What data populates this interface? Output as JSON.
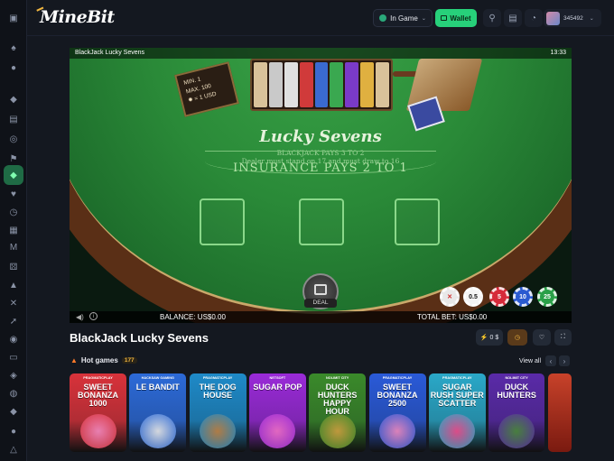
{
  "brand": "MineBit",
  "topbar": {
    "ingame_label": "In Game",
    "wallet_label": "Wallet",
    "user_id": "345492"
  },
  "sidebar": {
    "items": [
      {
        "icon": "collapse-icon",
        "glyph": "▣"
      },
      {
        "icon": "spade-icon",
        "glyph": "♠"
      },
      {
        "icon": "basketball-icon",
        "glyph": "●"
      },
      {
        "icon": "chat-icon",
        "glyph": "◆"
      },
      {
        "icon": "gift-icon",
        "glyph": "▤"
      },
      {
        "icon": "target-icon",
        "glyph": "◎"
      },
      {
        "icon": "flag-icon",
        "glyph": "⚑"
      },
      {
        "icon": "diamond-icon",
        "glyph": "◆",
        "active": true
      },
      {
        "icon": "heart-icon",
        "glyph": "♥"
      },
      {
        "icon": "clock-icon",
        "glyph": "◷"
      },
      {
        "icon": "calendar-icon",
        "glyph": "▦"
      },
      {
        "icon": "m-icon",
        "glyph": "M"
      },
      {
        "icon": "dice-icon",
        "glyph": "⚄"
      },
      {
        "icon": "thumb-icon",
        "glyph": "▲"
      },
      {
        "icon": "swords-icon",
        "glyph": "✕"
      },
      {
        "icon": "rocket-icon",
        "glyph": "➚"
      },
      {
        "icon": "users-icon",
        "glyph": "◉"
      },
      {
        "icon": "layers-icon",
        "glyph": "▭"
      },
      {
        "icon": "tag-icon",
        "glyph": "◈"
      },
      {
        "icon": "bulb-icon",
        "glyph": "◍"
      },
      {
        "icon": "ticket-icon",
        "glyph": "◆"
      },
      {
        "icon": "live-icon",
        "glyph": "●"
      },
      {
        "icon": "settings-icon",
        "glyph": "△"
      }
    ]
  },
  "game": {
    "header_title": "BlackJack Lucky Sevens",
    "time": "13:33",
    "limits_min": "MIN. 1",
    "limits_max": "MAX. 100",
    "limits_bonus": "= 1 USD",
    "felt_title": "Lucky Sevens",
    "felt_line1": "BLACKJACK PAYS 3 TO 2",
    "felt_line2": "Dealer must stand on 17 and must draw to 16",
    "insurance": "INSURANCE PAYS 2 TO 1",
    "deal_label": "DEAL",
    "balance": "BALANCE: US$0.00",
    "total_bet": "TOTAL BET: US$0.00",
    "chips": [
      {
        "label": "✕",
        "color": "#e8e8e8",
        "text": "#d02a2a"
      },
      {
        "label": "0.5",
        "color": "#f4f4f4",
        "text": "#111"
      },
      {
        "label": "5",
        "color": "#d62a3a",
        "text": "#fff"
      },
      {
        "label": "10",
        "color": "#2a5ad0",
        "text": "#fff"
      },
      {
        "label": "25",
        "color": "#2aa048",
        "text": "#fff"
      }
    ]
  },
  "page": {
    "game_title": "BlackJack Lucky Sevens",
    "favorite_count": "0 $",
    "hot_games_label": "Hot games",
    "hot_games_count": "177",
    "view_all": "View all"
  },
  "games": [
    {
      "provider": "PRAGMATICPLAY",
      "name": "SWEET BONANZA 1000",
      "bg": "#d8323a",
      "art": "#f48ac0"
    },
    {
      "provider": "HACKSAW GAMING",
      "name": "LE BANDIT",
      "bg": "#2c6ad8",
      "art": "#e8e8e8"
    },
    {
      "provider": "PRAGMATICPLAY",
      "name": "THE DOG HOUSE",
      "bg": "#1e8ac8",
      "art": "#c08040"
    },
    {
      "provider": "NETSOFT",
      "name": "SUGAR POP",
      "bg": "#9a2ad8",
      "art": "#f070c8"
    },
    {
      "provider": "NOLIMIT CITY",
      "name": "DUCK HUNTERS HAPPY HOUR",
      "bg": "#3a8a2a",
      "art": "#d0a040"
    },
    {
      "provider": "PRAGMATICPLAY",
      "name": "SWEET BONANZA 2500",
      "bg": "#2a5ad8",
      "art": "#f08ac0"
    },
    {
      "provider": "PRAGMATICPLAY",
      "name": "SUGAR RUSH SUPER SCATTER",
      "bg": "#2aa8c8",
      "art": "#f04a8a"
    },
    {
      "provider": "NOLIMIT CITY",
      "name": "DUCK HUNTERS",
      "bg": "#5a2aa8",
      "art": "#4a8a3a"
    }
  ],
  "colors": {
    "accent_green": "#27d07a",
    "background": "#141820"
  }
}
